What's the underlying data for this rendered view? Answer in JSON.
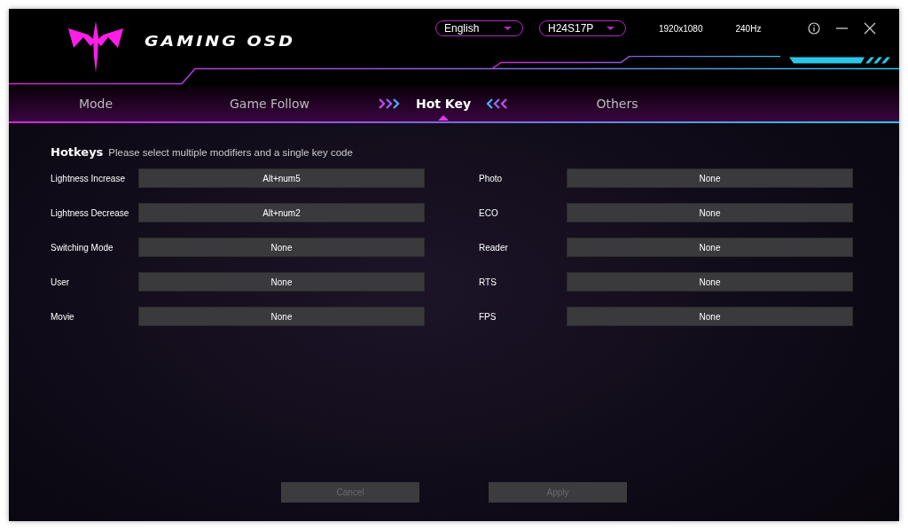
{
  "header": {
    "app_title": "GAMING OSD",
    "language": {
      "value": "English"
    },
    "monitor": {
      "value": "H24S17P"
    },
    "resolution": "1920x1080",
    "refresh_rate": "240Hz"
  },
  "tabs": [
    {
      "label": "Mode",
      "selected": false
    },
    {
      "label": "Game Follow",
      "selected": false
    },
    {
      "label": "Hot Key",
      "selected": true
    },
    {
      "label": "Others",
      "selected": false
    }
  ],
  "hotkeys": {
    "title": "Hotkeys",
    "hint": "Please select multiple modifiers and a single key code",
    "left": [
      {
        "label": "Lightness Increase",
        "value": "Alt+num5"
      },
      {
        "label": "Lightness Decrease",
        "value": "Alt+num2"
      },
      {
        "label": "Switching Mode",
        "value": "None"
      },
      {
        "label": "User",
        "value": "None"
      },
      {
        "label": "Movie",
        "value": "None"
      }
    ],
    "right": [
      {
        "label": "Photo",
        "value": "None"
      },
      {
        "label": "ECO",
        "value": "None"
      },
      {
        "label": "Reader",
        "value": "None"
      },
      {
        "label": "RTS",
        "value": "None"
      },
      {
        "label": "FPS",
        "value": "None"
      }
    ]
  },
  "buttons": [
    {
      "label": "Cancel",
      "disabled": true
    },
    {
      "label": "Apply",
      "disabled": true
    }
  ]
}
